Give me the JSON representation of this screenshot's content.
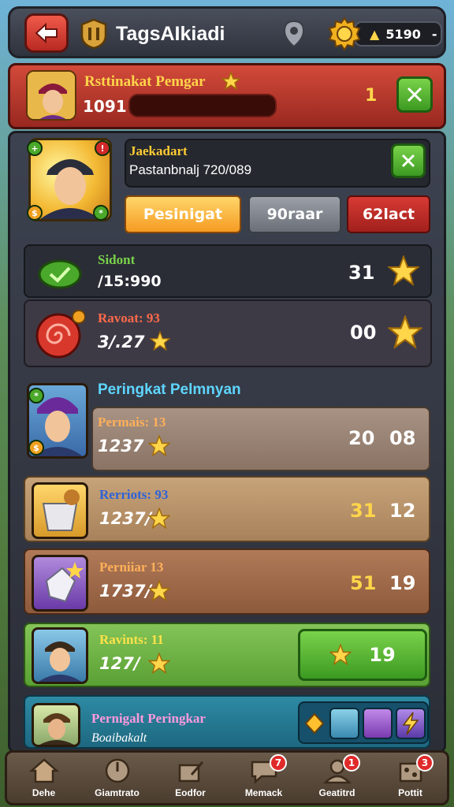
{
  "topbar": {
    "title": "TagsAIkiadi",
    "coins": "5190",
    "coin_symbol": "▲",
    "coin_menu": "-"
  },
  "header": {
    "title": "Rsttinakat Pemgar",
    "score": "1091",
    "rank": "1"
  },
  "profile": {
    "name": "Jaekadart",
    "subtitle": "Pastanbnalj 720/089",
    "tabs": [
      "Pesinigat",
      "90raar",
      "62lact"
    ]
  },
  "stats": [
    {
      "label": "Sidont",
      "value": "/15:990",
      "count": "31"
    },
    {
      "label": "Ravoat: 93",
      "value": "3/.27",
      "count": "00"
    }
  ],
  "ranking": {
    "title": "Peringkat Pelmnyan",
    "rows": [
      {
        "label": "Permais: 13",
        "value": "1237",
        "num_a": "20",
        "num_b": "08",
        "label_color": "#ffb05a",
        "num_a_color": "#ffffff"
      },
      {
        "label": "Rerriots: 93",
        "value": "1237/",
        "num_a": "31",
        "num_b": "12",
        "label_color": "#2d62d8",
        "num_a_color": "#ffd54a"
      },
      {
        "label": "Perniiar 13",
        "value": "1737/",
        "num_a": "51",
        "num_b": "19",
        "label_color": "#ffb05a",
        "num_a_color": "#ffd54a"
      },
      {
        "label": "Ravints: 11",
        "value": "127/",
        "num_a": "",
        "num_b": "19",
        "label_color": "#ffe24a",
        "num_a_color": "#ffd54a"
      }
    ],
    "footer": {
      "label": "Pernigalt Peringkar",
      "sub": "Boaibakalt"
    }
  },
  "nav": {
    "items": [
      {
        "label": "Dehe",
        "badge": ""
      },
      {
        "label": "Giamtrato",
        "badge": ""
      },
      {
        "label": "Eodfor",
        "badge": ""
      },
      {
        "label": "Memack",
        "badge": "7"
      },
      {
        "label": "Geatitrd",
        "badge": "1"
      },
      {
        "label": "Pottit",
        "badge": "3"
      }
    ]
  },
  "colors": {
    "accent_gold": "#ffd54a",
    "accent_red": "#d24a3a",
    "accent_green": "#5aa034",
    "accent_cyan": "#5ed6ff"
  }
}
